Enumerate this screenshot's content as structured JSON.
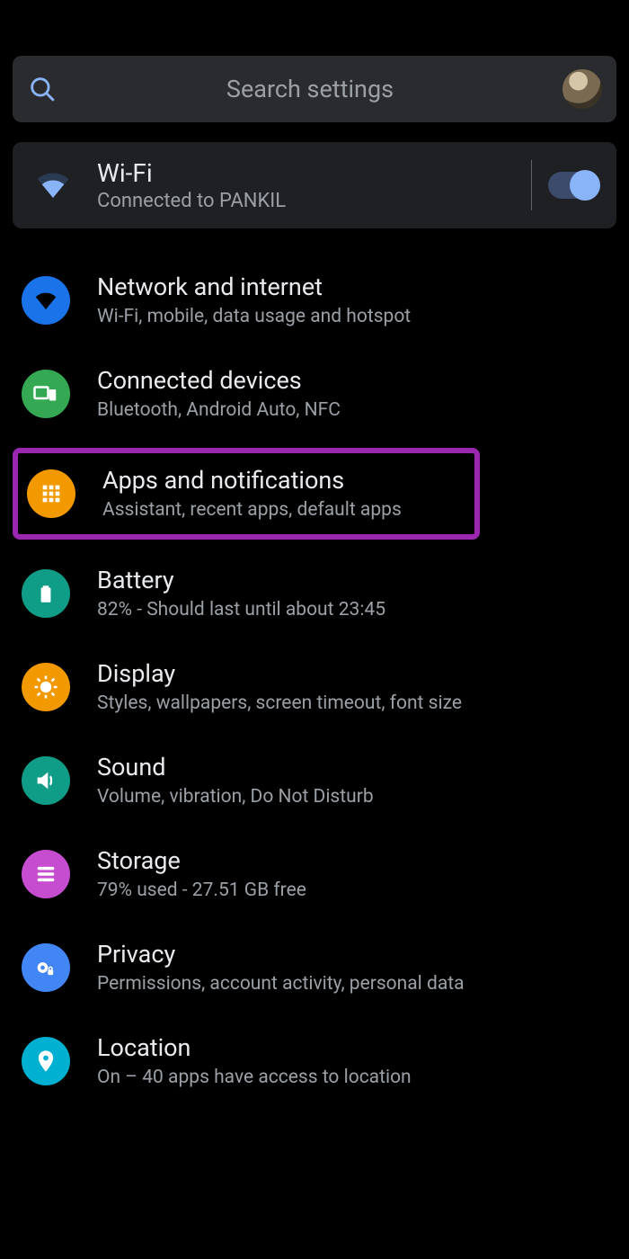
{
  "search": {
    "placeholder": "Search settings"
  },
  "wifi": {
    "title": "Wi-Fi",
    "subtitle": "Connected to PANKIL",
    "toggle_on": true
  },
  "items": [
    {
      "icon": "wifi-icon",
      "title": "Network and internet",
      "subtitle": "Wi-Fi, mobile, data usage and hotspot"
    },
    {
      "icon": "devices-icon",
      "title": "Connected devices",
      "subtitle": "Bluetooth, Android Auto, NFC"
    },
    {
      "icon": "apps-icon",
      "title": "Apps and notifications",
      "subtitle": "Assistant, recent apps, default apps"
    },
    {
      "icon": "battery-icon",
      "title": "Battery",
      "subtitle": "82% - Should last until about 23:45"
    },
    {
      "icon": "display-icon",
      "title": "Display",
      "subtitle": "Styles, wallpapers, screen timeout, font size"
    },
    {
      "icon": "sound-icon",
      "title": "Sound",
      "subtitle": "Volume, vibration, Do Not Disturb"
    },
    {
      "icon": "storage-icon",
      "title": "Storage",
      "subtitle": "79% used - 27.51 GB free"
    },
    {
      "icon": "privacy-icon",
      "title": "Privacy",
      "subtitle": "Permissions, account activity, personal data"
    },
    {
      "icon": "location-icon",
      "title": "Location",
      "subtitle": "On – 40 apps have access to location"
    }
  ],
  "highlight_index": 2
}
